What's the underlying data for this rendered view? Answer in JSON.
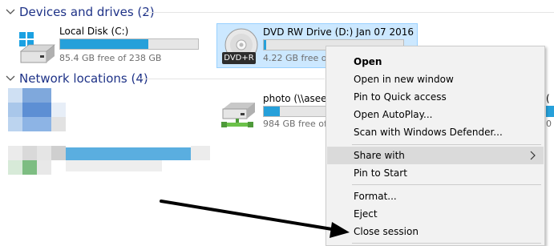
{
  "sections": {
    "devices": {
      "label": "Devices and drives (2)"
    },
    "network": {
      "label": "Network locations (4)"
    }
  },
  "drives": {
    "local": {
      "name": "Local Disk (C:)",
      "free": "85.4 GB free of 238 GB",
      "used_fraction": 0.64
    },
    "dvd": {
      "name": "DVD RW Drive (D:) Jan 07 2016",
      "free": "4.22 GB free of",
      "badge": "DVD+R",
      "used_fraction": 0.02
    }
  },
  "network_items": {
    "photo": {
      "name": "photo (\\\\aseer",
      "free": "984 GB free of",
      "used_fraction": 0.25
    },
    "right_partial": {
      "name": "(",
      "free": "0"
    }
  },
  "context_menu": {
    "items": [
      {
        "label": "Open",
        "bold": true
      },
      {
        "label": "Open in new window"
      },
      {
        "label": "Pin to Quick access"
      },
      {
        "label": "Open AutoPlay..."
      },
      {
        "label": "Scan with Windows Defender..."
      },
      {
        "label": "Share with",
        "submenu": true,
        "highlighted": true
      },
      {
        "label": "Pin to Start"
      },
      {
        "label": "Format..."
      },
      {
        "label": "Eject"
      },
      {
        "label": "Close session"
      }
    ]
  },
  "colors": {
    "header_text": "#1e3287",
    "bar_fill": "#26a0da",
    "selection": "#cce8ff",
    "arrow": "#000000"
  }
}
